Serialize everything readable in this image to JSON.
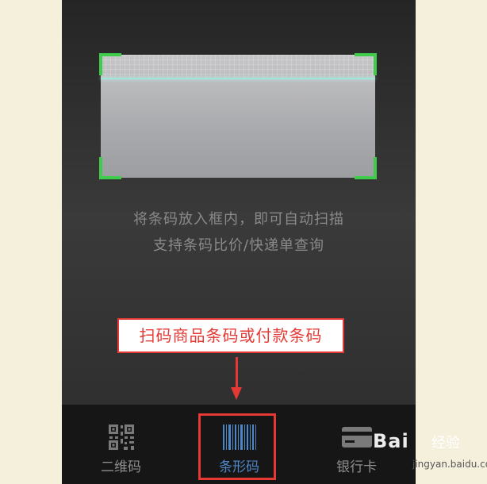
{
  "scanner": {
    "hint_line1": "将条码放入框内，即可自动扫描",
    "hint_line2": "支持条码比价/快递单查询"
  },
  "annotation": {
    "callout_text": "扫码商品条码或付款条码"
  },
  "tabs": [
    {
      "label": "二维码",
      "icon": "qr-code-icon"
    },
    {
      "label": "条形码",
      "icon": "barcode-icon",
      "active": true
    },
    {
      "label": "银行卡",
      "icon": "bank-card-icon"
    }
  ],
  "watermark": {
    "logo": "Bai",
    "text": "经验",
    "url": "jingyan.baidu.com"
  },
  "colors": {
    "frame_corner": "#3fcb4b",
    "active_tab": "#4d86c6",
    "annotation": "#e53935",
    "background": "#f5f0dc"
  }
}
